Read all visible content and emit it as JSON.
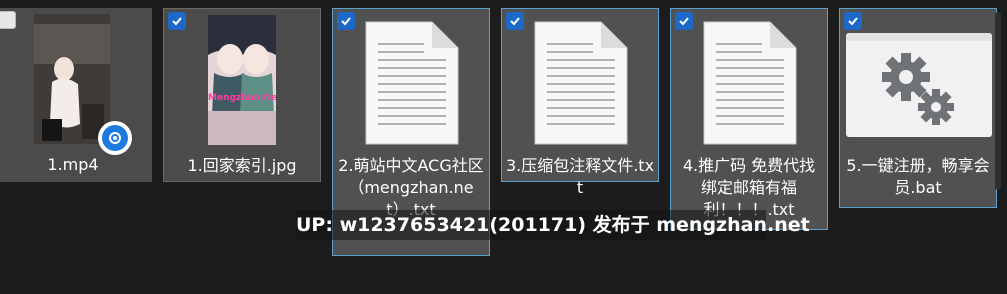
{
  "files": [
    {
      "name": "1.mp4",
      "selected": false,
      "type": "video"
    },
    {
      "name": "1.回家索引.jpg",
      "selected": false,
      "type": "image",
      "thumb_text": "Mengzhan.Net"
    },
    {
      "name": "2.萌站中文ACG社区（mengzhan.net）.txt",
      "selected": true,
      "type": "text"
    },
    {
      "name": "3.压缩包注释文件.txt",
      "selected": true,
      "type": "text"
    },
    {
      "name": "4.推广码 免费代找 绑定邮箱有福利！！！.txt",
      "selected": true,
      "type": "text"
    },
    {
      "name": "5.一键注册，畅享会员.bat",
      "selected": true,
      "type": "batch"
    }
  ],
  "overlay_text": "UP: w1237653421(201171) 发布于 mengzhan.net",
  "colors": {
    "check": "#1d68c9",
    "background": "#1c1c1c",
    "tile": "#4b4b4b"
  }
}
